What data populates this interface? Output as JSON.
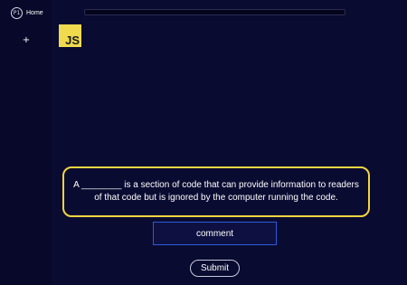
{
  "sidebar": {
    "home_label": "Home",
    "home_icon": "profile-icon",
    "add_label": "+"
  },
  "progress": {
    "fraction": 0
  },
  "logo": {
    "text": "JS",
    "color": "#f0db4f"
  },
  "question": {
    "text": "A ________ is a section of code that can provide information to readers of that code but is ignored by the computer running the code."
  },
  "answer": {
    "value": "comment"
  },
  "submit": {
    "label": "Submit"
  },
  "colors": {
    "background": "#0a0b31",
    "accent_yellow": "#f2d541",
    "input_border": "#2b5bd8"
  }
}
